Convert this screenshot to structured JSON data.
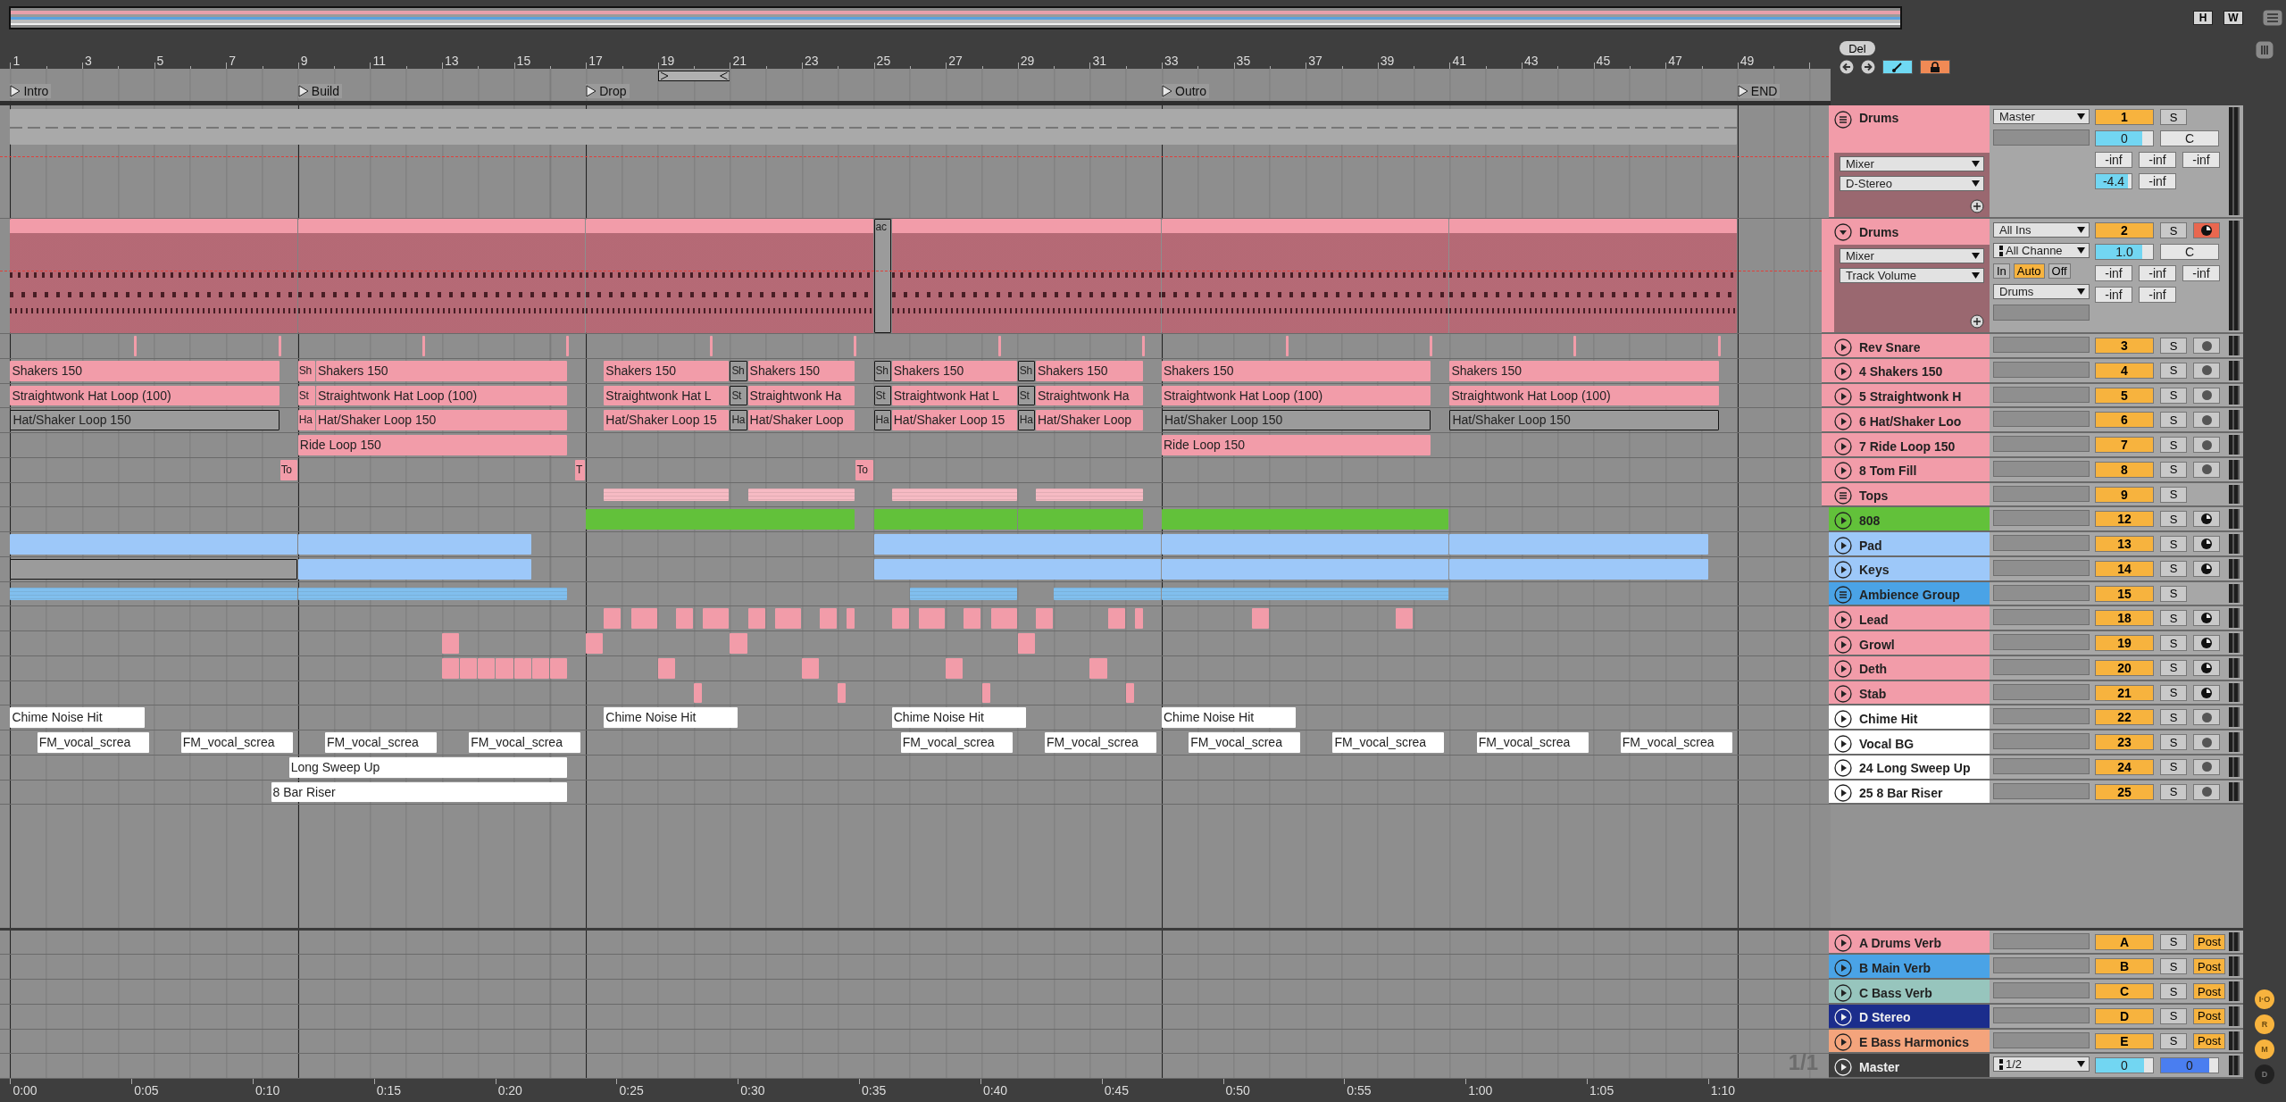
{
  "view_buttons": [
    "H",
    "W"
  ],
  "ruler": [
    "1",
    "3",
    "5",
    "7",
    "9",
    "11",
    "13",
    "15",
    "17",
    "19",
    "21",
    "23",
    "25",
    "27",
    "29",
    "31",
    "33",
    "35",
    "37",
    "39",
    "41",
    "43",
    "45",
    "47",
    "49"
  ],
  "locators": [
    {
      "name": "Intro"
    },
    {
      "name": "Build"
    },
    {
      "name": "Drop"
    },
    {
      "name": "Outro"
    },
    {
      "name": "END"
    }
  ],
  "edit_controls": {
    "delete": "Del",
    "draw_mode": true,
    "lock": true
  },
  "tracks": [
    {
      "name": "Drums",
      "kind": "group",
      "color": "#f29ca9",
      "number": "1",
      "active": true,
      "solo": false,
      "solo_label": "S",
      "automation": {
        "device": "Mixer",
        "parameter": "D-Stereo"
      },
      "output": "Master",
      "volume": {
        "value": "0",
        "level": 0.82
      },
      "pan": "C",
      "sends": [
        {
          "value": "-inf",
          "level": 0
        },
        {
          "value": "-inf",
          "level": 0
        },
        {
          "value": "-inf",
          "level": 0
        },
        {
          "value": "-4.4",
          "level": 0.9
        },
        {
          "value": "-inf",
          "level": 0
        }
      ],
      "clips": [
        {
          "active": true
        }
      ],
      "children": [
        {
          "name": "Drums",
          "kind": "midi",
          "color": "#f29ca9",
          "number": "2",
          "active": true,
          "solo": false,
          "solo_label": "S",
          "armed": true,
          "automation": {
            "device": "Mixer",
            "parameter": "Track Volume"
          },
          "input": "All Ins",
          "channel": "All Channe",
          "monitor": [
            {
              "label": "In",
              "selected": false
            },
            {
              "label": "Auto",
              "selected": true
            },
            {
              "label": "Off",
              "selected": false
            }
          ],
          "output": "Drums",
          "volume": {
            "value": "1.0",
            "level": 0.82
          },
          "pan": "C",
          "sends": [
            {
              "value": "-inf",
              "level": 0
            },
            {
              "value": "-inf",
              "level": 0
            },
            {
              "value": "-inf",
              "level": 0
            },
            {
              "value": "-inf",
              "level": 0
            },
            {
              "value": "-inf",
              "level": 0
            }
          ],
          "clips": [
            {
              "active": true
            },
            {
              "active": true
            },
            {
              "active": true
            },
            {
              "name": "ac",
              "active": false
            },
            {
              "active": true
            },
            {
              "active": true
            },
            {
              "active": true
            }
          ]
        },
        {
          "name": "Rev Snare",
          "kind": "audio",
          "color": "#f29ca9",
          "number": "3",
          "active": true,
          "solo": false,
          "solo_label": "S",
          "armed": false,
          "clips": [
            {
              "active": true
            },
            {
              "active": true
            },
            {
              "active": true
            },
            {
              "active": true
            },
            {
              "active": true
            },
            {
              "active": true
            },
            {
              "active": true
            },
            {
              "active": true
            },
            {
              "active": true
            },
            {
              "active": true
            },
            {
              "active": true
            },
            {
              "active": true
            }
          ]
        },
        {
          "name": "4 Shakers 150",
          "kind": "audio",
          "color": "#f29ca9",
          "number": "4",
          "active": true,
          "solo": false,
          "solo_label": "S",
          "armed": false,
          "clips": [
            {
              "name": "Shakers 150",
              "active": true
            },
            {
              "name": "Sh",
              "active": true
            },
            {
              "name": "Shakers 150",
              "active": true
            },
            {
              "name": "Shakers 150",
              "active": true
            },
            {
              "name": "Sh",
              "active": false
            },
            {
              "name": "Shakers 150",
              "active": true
            },
            {
              "name": "Sh",
              "active": false
            },
            {
              "name": "Shakers 150",
              "active": true
            },
            {
              "name": "Sh",
              "active": false
            },
            {
              "name": "Shakers 150",
              "active": true
            },
            {
              "name": "Shakers 150",
              "active": true
            },
            {
              "name": "Shakers 150",
              "active": true
            }
          ]
        },
        {
          "name": "5 Straightwonk H",
          "kind": "audio",
          "color": "#f29ca9",
          "number": "5",
          "active": true,
          "solo": false,
          "solo_label": "S",
          "armed": false,
          "clips": [
            {
              "name": "Straightwonk Hat Loop (100)",
              "active": true
            },
            {
              "name": "St",
              "active": true
            },
            {
              "name": "Straightwonk Hat Loop (100)",
              "active": true
            },
            {
              "name": "Straightwonk Hat L",
              "active": true
            },
            {
              "name": "St",
              "active": false
            },
            {
              "name": "Straightwonk Ha",
              "active": true
            },
            {
              "name": "St",
              "active": false
            },
            {
              "name": "Straightwonk Hat L",
              "active": true
            },
            {
              "name": "St",
              "active": false
            },
            {
              "name": "Straightwonk Ha",
              "active": true
            },
            {
              "name": "Straightwonk Hat Loop (100)",
              "active": true
            },
            {
              "name": "Straightwonk Hat Loop (100)",
              "active": true
            }
          ]
        },
        {
          "name": "6 Hat/Shaker Loo",
          "kind": "audio",
          "color": "#f29ca9",
          "number": "6",
          "active": true,
          "solo": false,
          "solo_label": "S",
          "armed": false,
          "clips": [
            {
              "name": "Hat/Shaker Loop 150",
              "active": false
            },
            {
              "name": "Ha",
              "active": true
            },
            {
              "name": "Hat/Shaker Loop 150",
              "active": true
            },
            {
              "name": "Hat/Shaker Loop 15",
              "active": true
            },
            {
              "name": "Ha",
              "active": false
            },
            {
              "name": "Hat/Shaker Loop",
              "active": true
            },
            {
              "name": "Ha",
              "active": false
            },
            {
              "name": "Hat/Shaker Loop 15",
              "active": true
            },
            {
              "name": "Ha",
              "active": false
            },
            {
              "name": "Hat/Shaker Loop",
              "active": true
            },
            {
              "name": "Hat/Shaker Loop 150",
              "active": false
            },
            {
              "name": "Hat/Shaker Loop 150",
              "active": false
            }
          ]
        },
        {
          "name": "7 Ride Loop 150",
          "kind": "audio",
          "color": "#f29ca9",
          "number": "7",
          "active": true,
          "solo": false,
          "solo_label": "S",
          "armed": false,
          "clips": [
            {
              "name": "Ride Loop 150",
              "active": true
            },
            {
              "name": "Ride Loop 150",
              "active": true
            }
          ]
        },
        {
          "name": "8 Tom Fill",
          "kind": "audio",
          "color": "#f29ca9",
          "number": "8",
          "active": true,
          "solo": false,
          "solo_label": "S",
          "armed": false,
          "clips": [
            {
              "name": "To",
              "active": true
            },
            {
              "name": "T",
              "active": true
            },
            {
              "name": "To",
              "active": true
            }
          ]
        },
        {
          "name": "Tops",
          "kind": "group",
          "color": "#f29ca9",
          "number": "9",
          "active": true,
          "solo": false,
          "solo_label": "S",
          "clips": [
            {
              "active": true
            },
            {
              "active": true
            },
            {
              "active": true
            },
            {
              "active": true
            }
          ]
        }
      ]
    },
    {
      "name": "808",
      "kind": "midi",
      "color": "#62c13a",
      "number": "12",
      "active": true,
      "solo": false,
      "solo_label": "S",
      "armed": false,
      "clips": [
        {
          "active": true
        },
        {
          "active": true
        },
        {
          "active": true
        },
        {
          "active": true
        }
      ]
    },
    {
      "name": "Pad",
      "kind": "midi",
      "color": "#9dc8f9",
      "number": "13",
      "active": true,
      "solo": false,
      "solo_label": "S",
      "armed": false,
      "clips": [
        {
          "active": true
        },
        {
          "active": true
        },
        {
          "active": true
        },
        {
          "active": true
        },
        {
          "active": true
        }
      ]
    },
    {
      "name": "Keys",
      "kind": "midi",
      "color": "#9dc8f9",
      "number": "14",
      "active": true,
      "solo": false,
      "solo_label": "S",
      "armed": false,
      "clips": [
        {
          "active": false
        },
        {
          "active": true
        },
        {
          "active": true
        },
        {
          "active": true
        },
        {
          "active": true
        }
      ]
    },
    {
      "name": "Ambience Group",
      "kind": "group",
      "color": "#4aa3e6",
      "number": "15",
      "active": true,
      "solo": false,
      "solo_label": "S",
      "clips": [
        {
          "active": true
        },
        {
          "active": true
        },
        {
          "active": true
        },
        {
          "active": true
        },
        {
          "active": true
        }
      ]
    },
    {
      "name": "Lead",
      "kind": "midi",
      "color": "#f29ca9",
      "number": "18",
      "active": true,
      "solo": false,
      "solo_label": "S",
      "armed": false,
      "clips": [
        {
          "active": true
        },
        {
          "active": true
        },
        {
          "active": true
        },
        {
          "active": true
        },
        {
          "active": true
        },
        {
          "active": true
        },
        {
          "active": true
        },
        {
          "active": true
        },
        {
          "active": true
        },
        {
          "active": true
        },
        {
          "active": true
        },
        {
          "active": true
        },
        {
          "active": true
        },
        {
          "active": true
        },
        {
          "active": true
        },
        {
          "active": true
        },
        {
          "active": true
        }
      ]
    },
    {
      "name": "Growl",
      "kind": "midi",
      "color": "#f29ca9",
      "number": "19",
      "active": true,
      "solo": false,
      "solo_label": "S",
      "armed": false,
      "clips": [
        {
          "active": true
        },
        {
          "active": true
        },
        {
          "active": true
        },
        {
          "active": true
        }
      ]
    },
    {
      "name": "Deth",
      "kind": "midi",
      "color": "#f29ca9",
      "number": "20",
      "active": true,
      "solo": false,
      "solo_label": "S",
      "armed": false,
      "clips": [
        {
          "active": true
        },
        {
          "active": true
        },
        {
          "active": true
        },
        {
          "active": true
        },
        {
          "active": true
        },
        {
          "active": true
        },
        {
          "active": true
        },
        {
          "active": true
        },
        {
          "active": true
        },
        {
          "active": true
        },
        {
          "active": true
        }
      ]
    },
    {
      "name": "Stab",
      "kind": "midi",
      "color": "#f29ca9",
      "number": "21",
      "active": true,
      "solo": false,
      "solo_label": "S",
      "armed": false,
      "clips": [
        {
          "active": true
        },
        {
          "active": true
        },
        {
          "active": true
        },
        {
          "active": true
        }
      ]
    },
    {
      "name": "Chime Hit",
      "kind": "audio",
      "color": "#ffffff",
      "number": "22",
      "active": true,
      "solo": false,
      "solo_label": "S",
      "armed": false,
      "clips": [
        {
          "name": "Chime Noise Hit",
          "active": true
        },
        {
          "name": "Chime Noise Hit",
          "active": true
        },
        {
          "name": "Chime Noise Hit",
          "active": true
        },
        {
          "name": "Chime Noise Hit",
          "active": true
        }
      ]
    },
    {
      "name": "Vocal BG",
      "kind": "audio",
      "color": "#ffffff",
      "number": "23",
      "active": true,
      "solo": false,
      "solo_label": "S",
      "armed": false,
      "clips": [
        {
          "name": "FM_vocal_screa",
          "active": true
        },
        {
          "name": "FM_vocal_screa",
          "active": true
        },
        {
          "name": "FM_vocal_screa",
          "active": true
        },
        {
          "name": "FM_vocal_screa",
          "active": true
        },
        {
          "name": "FM_vocal_screa",
          "active": true
        },
        {
          "name": "FM_vocal_screa",
          "active": true
        },
        {
          "name": "FM_vocal_screa",
          "active": true
        },
        {
          "name": "FM_vocal_screa",
          "active": true
        },
        {
          "name": "FM_vocal_screa",
          "active": true
        },
        {
          "name": "FM_vocal_screa",
          "active": true
        }
      ]
    },
    {
      "name": "24 Long Sweep Up",
      "kind": "audio",
      "color": "#ffffff",
      "number": "24",
      "active": true,
      "solo": false,
      "solo_label": "S",
      "armed": false,
      "clips": [
        {
          "name": "Long Sweep Up",
          "active": true
        }
      ]
    },
    {
      "name": "25 8 Bar Riser",
      "kind": "audio",
      "color": "#ffffff",
      "number": "25",
      "active": true,
      "solo": false,
      "solo_label": "S",
      "armed": false,
      "clips": [
        {
          "name": "8 Bar Riser",
          "active": true
        }
      ]
    }
  ],
  "returns": [
    {
      "name": "A Drums Verb",
      "kind": "return",
      "color": "#f29ca9",
      "number": "A",
      "active": true,
      "solo": false,
      "solo_label": "S",
      "send_mode": "Post"
    },
    {
      "name": "B Main Verb",
      "kind": "return",
      "color": "#4aa3e6",
      "number": "B",
      "active": true,
      "solo": false,
      "solo_label": "S",
      "send_mode": "Post"
    },
    {
      "name": "C Bass Verb",
      "kind": "return",
      "color": "#97c5bd",
      "number": "C",
      "active": true,
      "solo": false,
      "solo_label": "S",
      "send_mode": "Post"
    },
    {
      "name": "D Stereo",
      "kind": "return",
      "color": "#1b2d8c",
      "number": "D",
      "active": true,
      "solo": false,
      "solo_label": "S",
      "send_mode": "Post"
    },
    {
      "name": "E Bass Harmonics",
      "kind": "return",
      "color": "#f4a47c",
      "number": "E",
      "active": true,
      "solo": false,
      "solo_label": "S",
      "send_mode": "Post"
    },
    {
      "name": "Master",
      "kind": "master",
      "color": "#3d3d3d",
      "output": "1/2",
      "volume": {
        "value": "0",
        "level": 0.85
      },
      "cue": {
        "value": "0",
        "level": 0.85
      }
    }
  ],
  "page_label": "1/1",
  "time_ruler": [
    "0:00",
    "0:05",
    "0:10",
    "0:15",
    "0:20",
    "0:25",
    "0:30",
    "0:35",
    "0:40",
    "0:45",
    "0:50",
    "0:55",
    "1:00",
    "1:05",
    "1:10"
  ],
  "side_buttons": [
    {
      "label": "I·O",
      "on": true
    },
    {
      "label": "R",
      "on": true
    },
    {
      "label": "M",
      "on": true
    },
    {
      "label": "D",
      "on": false
    }
  ]
}
